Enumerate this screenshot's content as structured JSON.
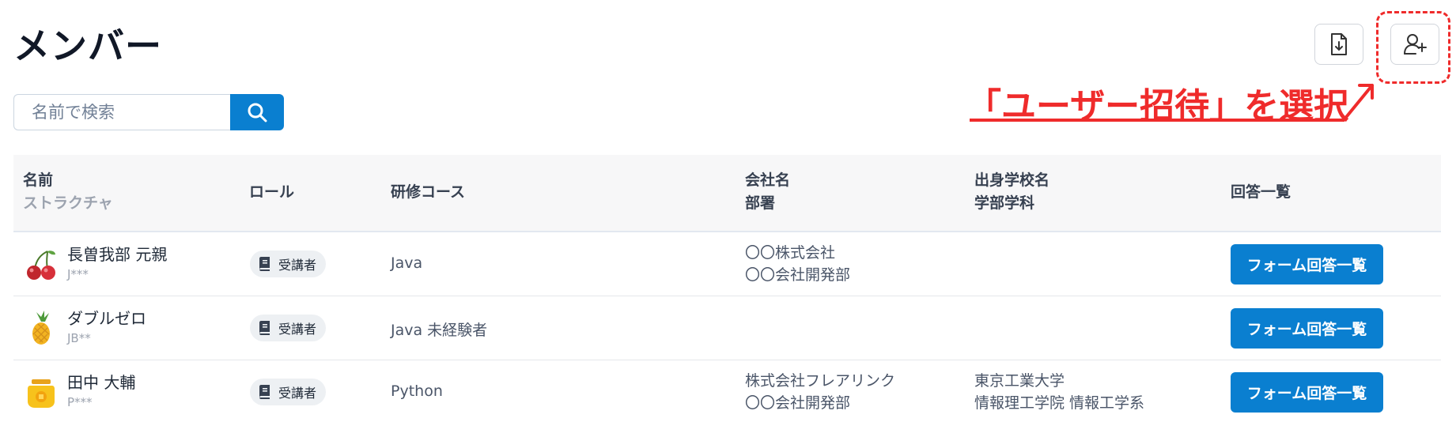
{
  "page": {
    "title": "メンバー"
  },
  "toolbar": {
    "download_icon": "file-download-icon",
    "invite_icon": "user-plus-icon"
  },
  "annotation": {
    "text": "「ユーザー招待」を選択",
    "color": "#ef2b2b"
  },
  "search": {
    "placeholder": "名前で検索",
    "value": ""
  },
  "table": {
    "headers": {
      "name": "名前",
      "name_sub": "ストラクチャ",
      "role": "ロール",
      "course": "研修コース",
      "company": "会社名",
      "company_sub": "部署",
      "school": "出身学校名",
      "school_sub": "学部学科",
      "answers": "回答一覧"
    },
    "rows": [
      {
        "avatar": "cherry-icon",
        "name": "長曽我部 元親",
        "code": "J***",
        "role": "受講者",
        "course": "Java",
        "company": "〇〇株式会社",
        "department": "〇〇会社開発部",
        "school": "",
        "faculty": "",
        "button": "フォーム回答一覧"
      },
      {
        "avatar": "pineapple-icon",
        "name": "ダブルゼロ",
        "code": "JB**",
        "role": "受講者",
        "course": "Java 未経験者",
        "company": "",
        "department": "",
        "school": "",
        "faculty": "",
        "button": "フォーム回答一覧"
      },
      {
        "avatar": "honey-jar-icon",
        "name": "田中 大輔",
        "code": "P***",
        "role": "受講者",
        "course": "Python",
        "company": "株式会社フレアリンク",
        "department": "〇〇会社開発部",
        "school": "東京工業大学",
        "faculty": "情報理工学院 情報工学系",
        "button": "フォーム回答一覧"
      }
    ]
  },
  "colors": {
    "primary": "#0a7fd0",
    "annotation": "#ef2b2b",
    "header_bg": "#f7f7f8"
  }
}
